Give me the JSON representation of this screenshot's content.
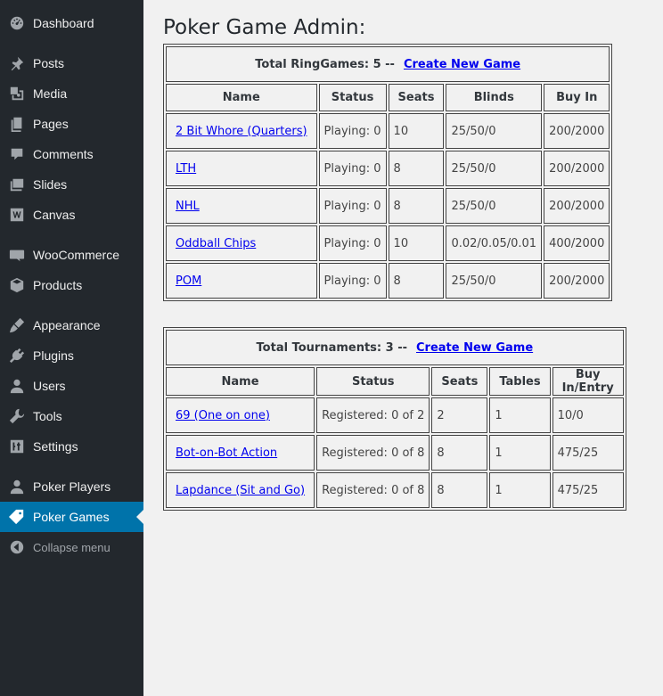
{
  "sidebar": {
    "items": [
      {
        "label": "Dashboard",
        "icon": "dashboard-icon"
      },
      {
        "label": "Posts",
        "icon": "pin-icon"
      },
      {
        "label": "Media",
        "icon": "media-icon"
      },
      {
        "label": "Pages",
        "icon": "pages-icon"
      },
      {
        "label": "Comments",
        "icon": "comment-icon"
      },
      {
        "label": "Slides",
        "icon": "slides-icon"
      },
      {
        "label": "Canvas",
        "icon": "canvas-w-icon"
      },
      {
        "label": "WooCommerce",
        "icon": "woo-icon"
      },
      {
        "label": "Products",
        "icon": "box-icon"
      },
      {
        "label": "Appearance",
        "icon": "brush-icon"
      },
      {
        "label": "Plugins",
        "icon": "plug-icon"
      },
      {
        "label": "Users",
        "icon": "user-icon"
      },
      {
        "label": "Tools",
        "icon": "wrench-icon"
      },
      {
        "label": "Settings",
        "icon": "sliders-icon"
      },
      {
        "label": "Poker Players",
        "icon": "user-icon"
      },
      {
        "label": "Poker Games",
        "icon": "tag-icon",
        "active": true
      },
      {
        "label": "Collapse menu",
        "icon": "collapse-arrow-icon"
      }
    ]
  },
  "page": {
    "title": "Poker Game Admin:"
  },
  "ring": {
    "caption": "Total RingGames: 5 --",
    "create_link": "Create New Game",
    "headers": [
      "Name",
      "Status",
      "Seats",
      "Blinds",
      "Buy In"
    ],
    "rows": [
      [
        "2 Bit Whore (Quarters)",
        "Playing: 0",
        "10",
        "25/50/0",
        "200/2000"
      ],
      [
        "LTH",
        "Playing: 0",
        "8",
        "25/50/0",
        "200/2000"
      ],
      [
        "NHL",
        "Playing: 0",
        "8",
        "25/50/0",
        "200/2000"
      ],
      [
        "Oddball Chips",
        "Playing: 0",
        "10",
        "0.02/0.05/0.01",
        "400/2000"
      ],
      [
        "POM",
        "Playing: 0",
        "8",
        "25/50/0",
        "200/2000"
      ]
    ]
  },
  "tourn": {
    "caption": "Total Tournaments: 3 --",
    "create_link": "Create New Game",
    "headers": [
      "Name",
      "Status",
      "Seats",
      "Tables",
      "Buy In/Entry"
    ],
    "rows": [
      [
        "69 (One on one)",
        "Registered: 0 of 2",
        "2",
        "1",
        "10/0"
      ],
      [
        "Bot-on-Bot Action",
        "Registered: 0 of 8",
        "8",
        "1",
        "475/25"
      ],
      [
        "Lapdance (Sit and Go)",
        "Registered: 0 of 8",
        "8",
        "1",
        "475/25"
      ]
    ]
  },
  "colors": {
    "sidebar_bg": "#23282d",
    "active_bg": "#0073aa",
    "page_bg": "#f1f1f1",
    "link": "#0000ee"
  }
}
